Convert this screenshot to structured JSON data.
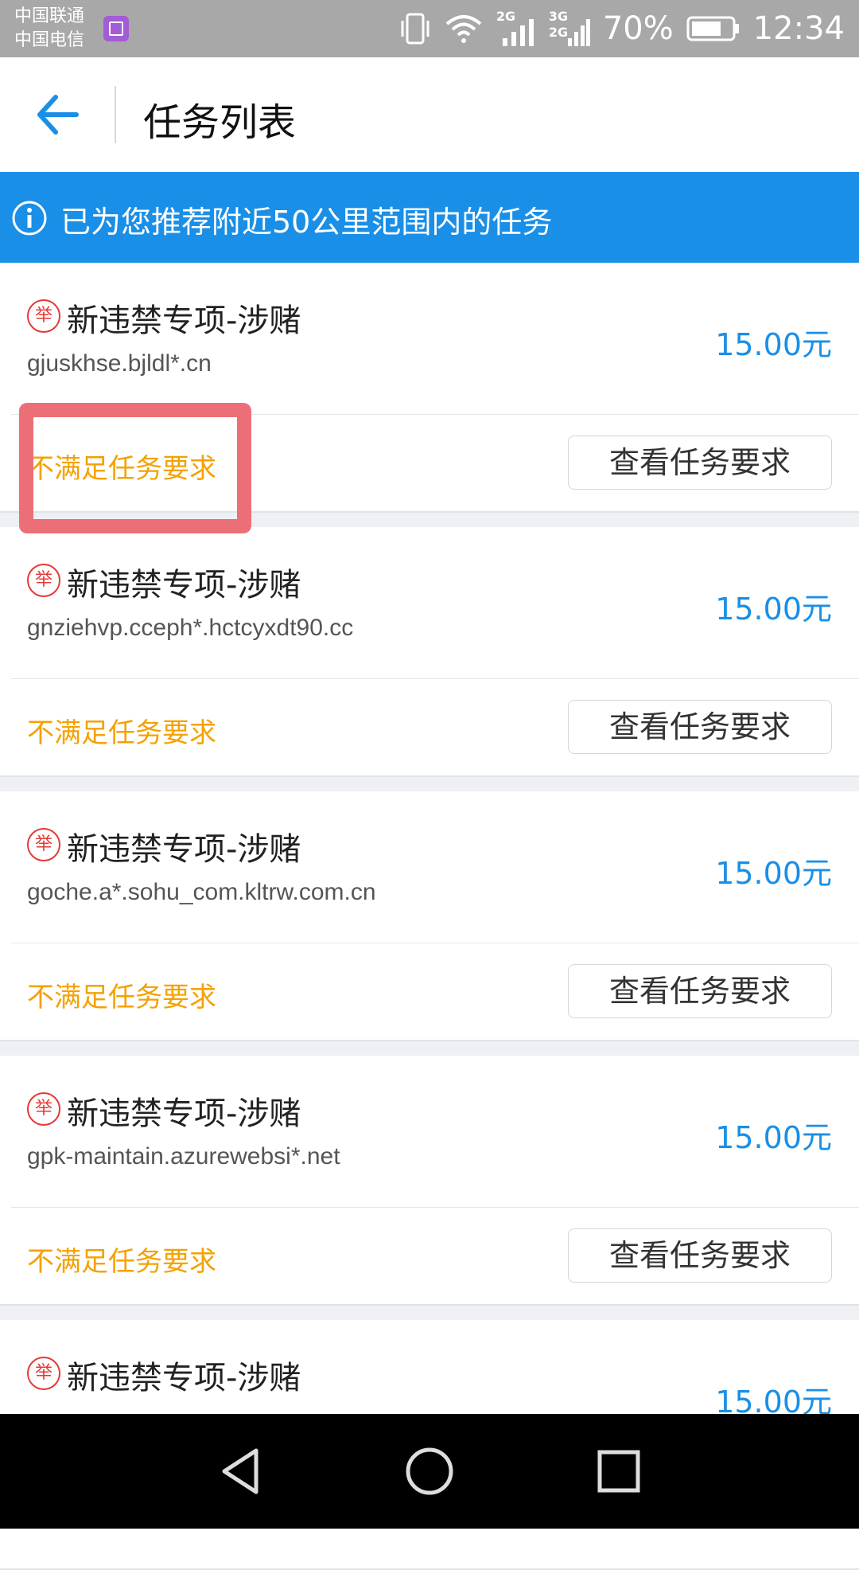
{
  "status_bar": {
    "carrier_1": "中国联通",
    "carrier_2": "中国电信",
    "net_1": "2G",
    "net_2_top": "3G",
    "net_2_bottom": "2G",
    "battery": "70%",
    "time": "12:34",
    "icons": [
      "gallery-icon",
      "vibrate-icon",
      "wifi-icon",
      "signal-icon",
      "signal-icon",
      "battery-icon"
    ]
  },
  "header": {
    "back_icon": "arrow-left-icon",
    "title": "任务列表"
  },
  "banner": {
    "icon": "info-icon",
    "text": "已为您推荐附近50公里范围内的任务",
    "color": "#1a8fe7"
  },
  "tasks": [
    {
      "badge": "举",
      "title": "新违禁专项-涉赌",
      "domain": "gjuskhse.bjldl*.cn",
      "price": "15.00元",
      "status": "不满足任务要求",
      "button": "查看任务要求"
    },
    {
      "badge": "举",
      "title": "新违禁专项-涉赌",
      "domain": "gnziehvp.cceph*.hctcyxdt90.cc",
      "price": "15.00元",
      "status": "不满足任务要求",
      "button": "查看任务要求"
    },
    {
      "badge": "举",
      "title": "新违禁专项-涉赌",
      "domain": "goche.a*.sohu_com.kltrw.com.cn",
      "price": "15.00元",
      "status": "不满足任务要求",
      "button": "查看任务要求"
    },
    {
      "badge": "举",
      "title": "新违禁专项-涉赌",
      "domain": "gpk-maintain.azurewebsi*.net",
      "price": "15.00元",
      "status": "不满足任务要求",
      "button": "查看任务要求"
    },
    {
      "badge": "举",
      "title": "新违禁专项-涉赌",
      "domain": "",
      "price": "15.00元",
      "status": "",
      "button": ""
    }
  ],
  "colors": {
    "price": "#1a8fe7",
    "status_warning": "#f5a100",
    "highlight": "#ec6f78"
  },
  "nav": {
    "back": "triangle-back-icon",
    "home": "circle-home-icon",
    "recent": "square-recent-icon"
  }
}
